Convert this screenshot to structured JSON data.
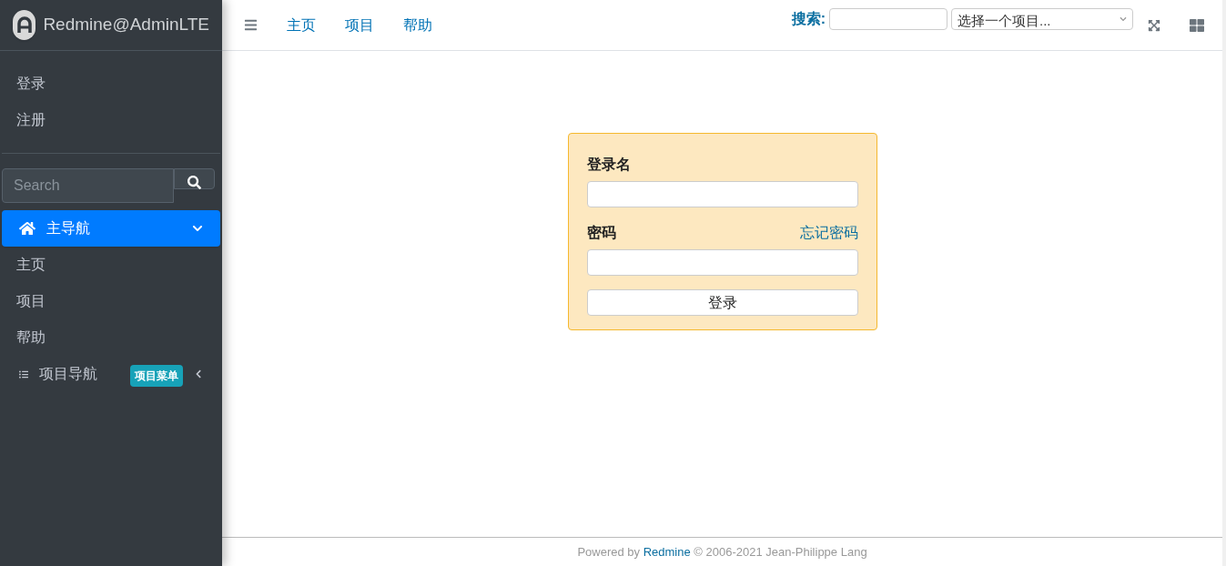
{
  "brand": {
    "title": "Redmine@AdminLTE"
  },
  "sidebar": {
    "account_links": [
      "登录",
      "注册"
    ],
    "search": {
      "placeholder": "Search"
    },
    "groups": [
      {
        "label": "主导航",
        "selected": true,
        "expanded": true,
        "children": [
          {
            "label": "主页"
          },
          {
            "label": "项目"
          },
          {
            "label": "帮助"
          }
        ]
      },
      {
        "label": "项目导航",
        "selected": false,
        "expanded": false,
        "badge": "项目菜单"
      }
    ]
  },
  "topbar": {
    "links": [
      "主页",
      "项目",
      "帮助"
    ],
    "search_label": "搜索:",
    "project_select": "选择一个项目..."
  },
  "login": {
    "username_label": "登录名",
    "password_label": "密码",
    "forgot_link": "忘记密码",
    "submit": "登录"
  },
  "footer": {
    "before": "Powered by",
    "link": "Redmine",
    "after": "© 2006-2021 Jean-Philippe Lang"
  }
}
